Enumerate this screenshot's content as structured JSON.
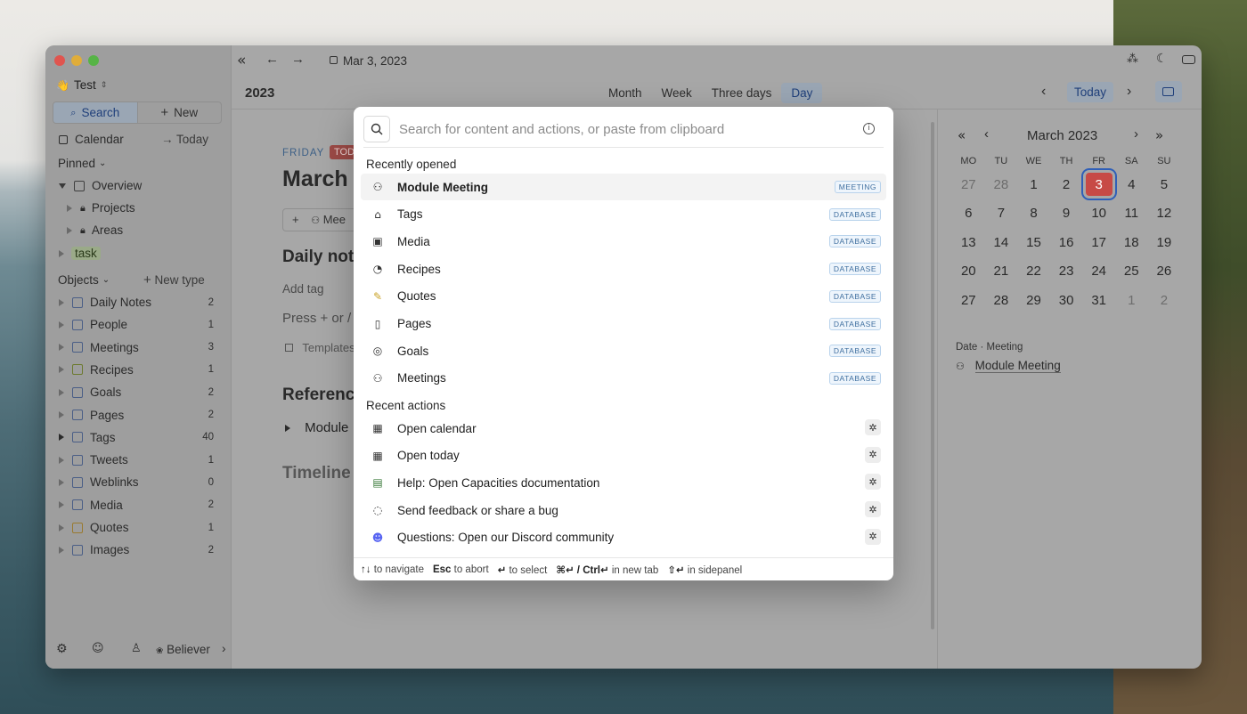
{
  "colors": {
    "accent": "#2f5fb8",
    "today": "#c74a46",
    "badge_bg": "#eef5fc",
    "badge_text": "#3f6f9f"
  },
  "workspace": {
    "name": "Test",
    "emoji": "👋"
  },
  "sidebar": {
    "search_label": "Search",
    "new_label": "New",
    "calendar_label": "Calendar",
    "today_label": "Today",
    "pinned_label": "Pinned",
    "pinned": [
      {
        "label": "Overview",
        "icon": "page-icon"
      },
      {
        "label": "Projects",
        "icon": "lock-icon"
      },
      {
        "label": "Areas",
        "icon": "lock-icon"
      },
      {
        "label": "task",
        "icon": "tag-icon"
      }
    ],
    "objects_label": "Objects",
    "new_type_label": "New type",
    "objects": [
      {
        "label": "Daily Notes",
        "count": "2"
      },
      {
        "label": "People",
        "count": "1"
      },
      {
        "label": "Meetings",
        "count": "3"
      },
      {
        "label": "Recipes",
        "count": "1"
      },
      {
        "label": "Goals",
        "count": "2"
      },
      {
        "label": "Pages",
        "count": "2"
      },
      {
        "label": "Tags",
        "count": "40"
      },
      {
        "label": "Tweets",
        "count": "1"
      },
      {
        "label": "Weblinks",
        "count": "0"
      },
      {
        "label": "Media",
        "count": "2"
      },
      {
        "label": "Quotes",
        "count": "1"
      },
      {
        "label": "Images",
        "count": "2"
      }
    ],
    "footer_user": "Believer"
  },
  "topbar": {
    "date": "Mar 3, 2023"
  },
  "header": {
    "year": "2023",
    "views": [
      "Month",
      "Week",
      "Three days",
      "Day"
    ],
    "active_view": "Day",
    "today_button": "Today"
  },
  "content": {
    "weekday": "FRIDAY",
    "today_badge": "TOD",
    "title": "March",
    "meeting_chip": "Mee",
    "daily_notes_heading": "Daily note",
    "add_tag": "Add tag",
    "press_hint": "Press + or /",
    "templates": "Templates",
    "references_heading": "Referenc",
    "module_ref": "Module",
    "timeline_heading": "Timeline"
  },
  "minical": {
    "title": "March 2023",
    "weekdays": [
      "MO",
      "TU",
      "WE",
      "TH",
      "FR",
      "SA",
      "SU"
    ],
    "weeks": [
      [
        "27",
        "28",
        "1",
        "2",
        "3",
        "4",
        "5"
      ],
      [
        "6",
        "7",
        "8",
        "9",
        "10",
        "11",
        "12"
      ],
      [
        "13",
        "14",
        "15",
        "16",
        "17",
        "18",
        "19"
      ],
      [
        "20",
        "21",
        "22",
        "23",
        "24",
        "25",
        "26"
      ],
      [
        "27",
        "28",
        "29",
        "30",
        "31",
        "1",
        "2"
      ]
    ],
    "today": "3",
    "events_label": "Date · Meeting",
    "event": "Module Meeting"
  },
  "palette": {
    "placeholder": "Search for content and actions, or paste from clipboard",
    "recent_opened_label": "Recently opened",
    "recent_opened": [
      {
        "label": "Module Meeting",
        "badge": "MEETING",
        "icon": "meeting-icon"
      },
      {
        "label": "Tags",
        "badge": "DATABASE",
        "icon": "tag-icon"
      },
      {
        "label": "Media",
        "badge": "DATABASE",
        "icon": "media-icon"
      },
      {
        "label": "Recipes",
        "badge": "DATABASE",
        "icon": "recipe-icon"
      },
      {
        "label": "Quotes",
        "badge": "DATABASE",
        "icon": "quote-icon"
      },
      {
        "label": "Pages",
        "badge": "DATABASE",
        "icon": "page-icon"
      },
      {
        "label": "Goals",
        "badge": "DATABASE",
        "icon": "goal-icon"
      },
      {
        "label": "Meetings",
        "badge": "DATABASE",
        "icon": "meeting-icon"
      }
    ],
    "recent_actions_label": "Recent actions",
    "recent_actions": [
      {
        "label": "Open calendar",
        "icon": "calendar-icon"
      },
      {
        "label": "Open today",
        "icon": "calendar-icon"
      },
      {
        "label": "Help: Open Capacities documentation",
        "icon": "books-icon"
      },
      {
        "label": "Send feedback or share a bug",
        "icon": "lightbulb-icon"
      },
      {
        "label": "Questions: Open our Discord community",
        "icon": "discord-icon"
      }
    ],
    "footer": {
      "navigate_keys": "↑↓",
      "navigate": "to navigate",
      "abort_key": "Esc",
      "abort": "to abort",
      "select_key": "↵",
      "select": "to select",
      "newtab_key": "⌘↵ / Ctrl↵",
      "newtab": "in new tab",
      "side_key": "⇧↵",
      "side": "in sidepanel"
    }
  }
}
